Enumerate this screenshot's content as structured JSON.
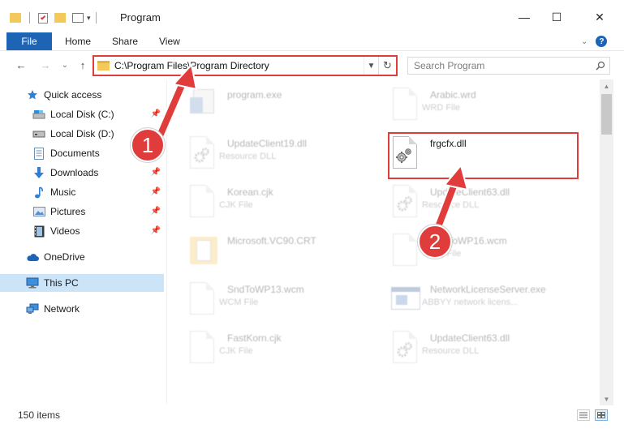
{
  "window": {
    "title": "Program",
    "minimize": "—",
    "maximize": "☐",
    "close": "✕"
  },
  "ribbon": {
    "tabs": [
      "File",
      "Home",
      "Share",
      "View"
    ],
    "help": "?"
  },
  "nav": {
    "back": "←",
    "forward": "→",
    "recent": "⌄",
    "up": "↑"
  },
  "address": {
    "path": "C:\\Program Files\\Program Directory",
    "refresh": "↻"
  },
  "search": {
    "placeholder": "Search Program"
  },
  "sidebar": {
    "items": [
      {
        "label": "Quick access",
        "icon": "star-icon",
        "pinned": false
      },
      {
        "label": "Local Disk (C:)",
        "icon": "drive-icon",
        "pinned": true
      },
      {
        "label": "Local Disk (D:)",
        "icon": "drive-icon",
        "pinned": false
      },
      {
        "label": "Documents",
        "icon": "documents-icon",
        "pinned": true
      },
      {
        "label": "Downloads",
        "icon": "download-icon",
        "pinned": true
      },
      {
        "label": "Music",
        "icon": "music-icon",
        "pinned": true
      },
      {
        "label": "Pictures",
        "icon": "pictures-icon",
        "pinned": true
      },
      {
        "label": "Videos",
        "icon": "video-icon",
        "pinned": true
      },
      {
        "label": "OneDrive",
        "icon": "cloud-icon",
        "pinned": false
      },
      {
        "label": "This PC",
        "icon": "computer-icon",
        "pinned": false,
        "selected": true
      },
      {
        "label": "Network",
        "icon": "network-icon",
        "pinned": false
      }
    ]
  },
  "files": [
    {
      "name": "program.exe",
      "type": "",
      "icon": "exe-icon",
      "faded": true
    },
    {
      "name": "Arabic.wrd",
      "type": "WRD File",
      "icon": "document-icon",
      "faded": true
    },
    {
      "name": "UpdateClient19.dll",
      "type": "Resource DLL",
      "icon": "dll-gear-icon",
      "faded": true
    },
    {
      "name": "frgcfx.dll",
      "type": "",
      "icon": "dll-gear-icon",
      "faded": false
    },
    {
      "name": "Korean.cjk",
      "type": "CJK File",
      "icon": "document-icon",
      "faded": true
    },
    {
      "name": "UpdateClient63.dll",
      "type": "Resource DLL",
      "icon": "dll-gear-icon",
      "faded": true
    },
    {
      "name": "Microsoft.VC90.CRT",
      "type": "",
      "icon": "folder-icon",
      "faded": true
    },
    {
      "name": "SndToWP16.wcm",
      "type": "WCM File",
      "icon": "document-icon",
      "faded": true
    },
    {
      "name": "SndToWP13.wcm",
      "type": "WCM File",
      "icon": "document-icon",
      "faded": true
    },
    {
      "name": "NetworkLicenseServer.exe",
      "type": "ABBYY network licens...",
      "icon": "window-app-icon",
      "faded": true
    },
    {
      "name": "FastKorn.cjk",
      "type": "CJK File",
      "icon": "document-icon",
      "faded": true
    },
    {
      "name": "UpdateClient63.dll",
      "type": "Resource DLL",
      "icon": "dll-gear-icon",
      "faded": true
    }
  ],
  "status": {
    "count": "150 items"
  },
  "annotations": {
    "step1": "1",
    "step2": "2"
  },
  "colors": {
    "accent": "#1e64b4",
    "highlight": "#e03c3c",
    "selection": "#cce4f7"
  }
}
